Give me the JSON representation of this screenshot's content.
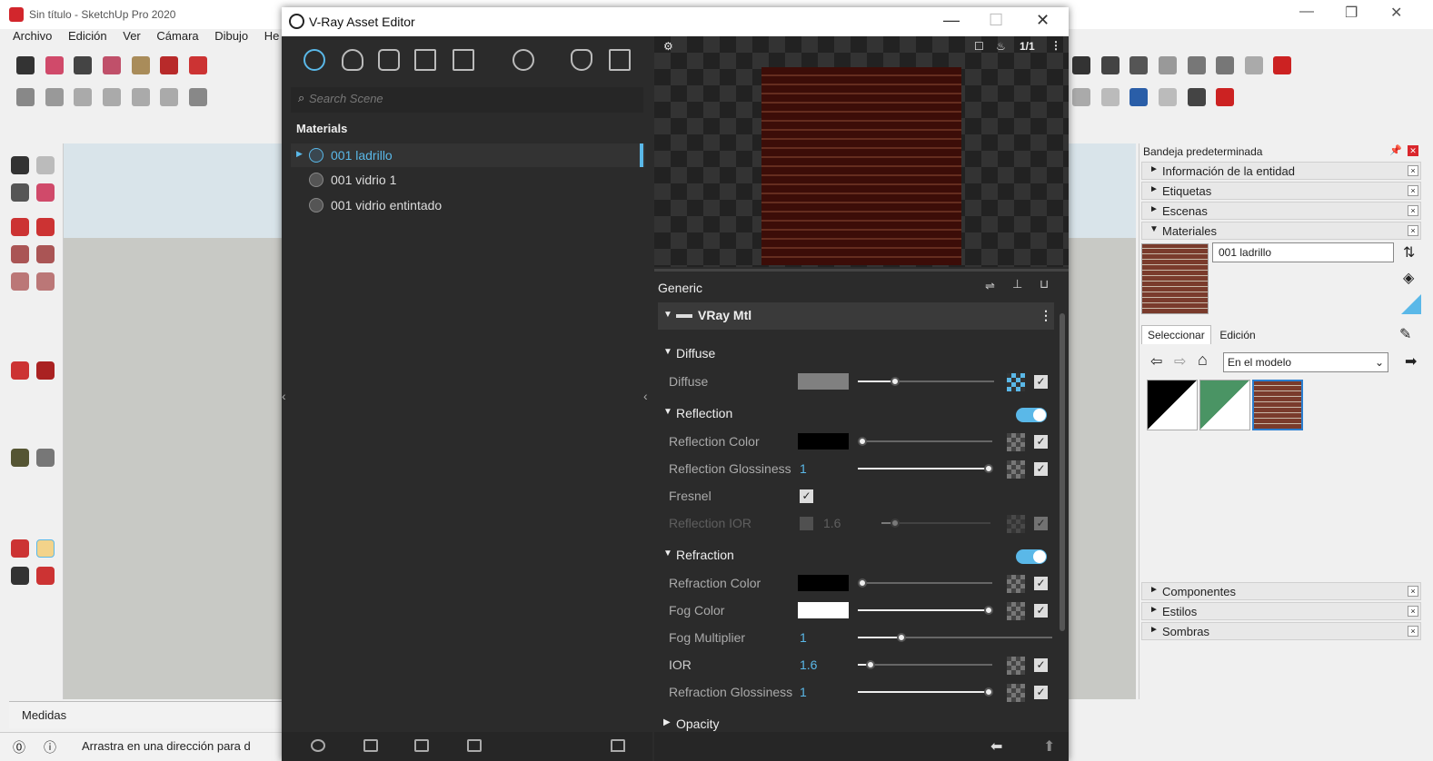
{
  "sketchup": {
    "title": "Sin título - SketchUp Pro 2020",
    "menu": [
      "Archivo",
      "Edición",
      "Ver",
      "Cámara",
      "Dibujo",
      "He"
    ],
    "measures_label": "Medidas",
    "status_text": "Arrastra en una dirección para d"
  },
  "tray": {
    "title": "Bandeja predeterminada",
    "panels_top": [
      {
        "label": "Información de la entidad",
        "arrow": "►"
      },
      {
        "label": "Etiquetas",
        "arrow": "►"
      },
      {
        "label": "Escenas",
        "arrow": "►"
      },
      {
        "label": "Materiales",
        "arrow": "▼"
      }
    ],
    "material_name": "001 ladrillo",
    "tabs": [
      "Seleccionar",
      "Edición"
    ],
    "collection": "En el modelo",
    "panels_bottom": [
      {
        "label": "Componentes",
        "arrow": "►"
      },
      {
        "label": "Estilos",
        "arrow": "►"
      },
      {
        "label": "Sombras",
        "arrow": "►"
      }
    ]
  },
  "vray": {
    "title": "V-Ray Asset Editor",
    "search_placeholder": "Search Scene",
    "materials_header": "Materials",
    "materials": [
      "001 ladrillo",
      "001 vidrio 1",
      "001 vidrio entintado"
    ],
    "preview_ratio": "1/1",
    "generic_label": "Generic",
    "mtl_label": "VRay Mtl",
    "sections": {
      "diffuse": "Diffuse",
      "reflection": "Reflection",
      "refraction": "Refraction",
      "opacity": "Opacity"
    },
    "params": {
      "diffuse": "Diffuse",
      "reflection_color": "Reflection Color",
      "reflection_glossiness": "Reflection Glossiness",
      "reflection_glossiness_val": "1",
      "fresnel": "Fresnel",
      "reflection_ior": "Reflection IOR",
      "reflection_ior_val": "1.6",
      "refraction_color": "Refraction Color",
      "fog_color": "Fog Color",
      "fog_multiplier": "Fog Multiplier",
      "fog_multiplier_val": "1",
      "ior": "IOR",
      "ior_val": "1.6",
      "refraction_glossiness": "Refraction Glossiness",
      "refraction_glossiness_val": "1"
    },
    "colors": {
      "accent": "#5ab8e8",
      "diffuse": "#808080",
      "reflection": "#000000",
      "refraction": "#000000",
      "fog": "#ffffff"
    }
  }
}
